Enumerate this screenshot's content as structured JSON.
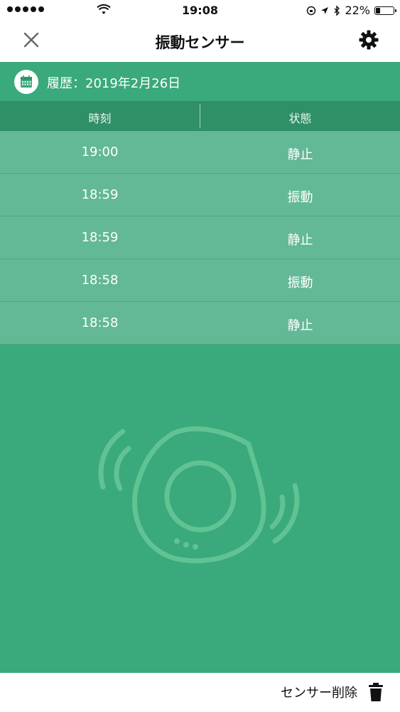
{
  "status_bar": {
    "time": "19:08",
    "battery": "22%"
  },
  "nav": {
    "title": "振動センサー",
    "close_icon": "close-icon",
    "settings_icon": "gear-icon"
  },
  "history": {
    "label": "履歴：2019年2月26日",
    "icon": "calendar-icon"
  },
  "table": {
    "headers": [
      "時刻",
      "状態"
    ],
    "rows": [
      {
        "time": "19:00",
        "state": "静止"
      },
      {
        "time": "18:59",
        "state": "振動"
      },
      {
        "time": "18:59",
        "state": "静止"
      },
      {
        "time": "18:58",
        "state": "振動"
      },
      {
        "time": "18:58",
        "state": "静止"
      }
    ]
  },
  "footer": {
    "delete_label": "センサー削除",
    "delete_icon": "trash-icon"
  },
  "colors": {
    "green": "#3aa97b",
    "green_dark": "#2f8f67",
    "row": "#63b896"
  }
}
